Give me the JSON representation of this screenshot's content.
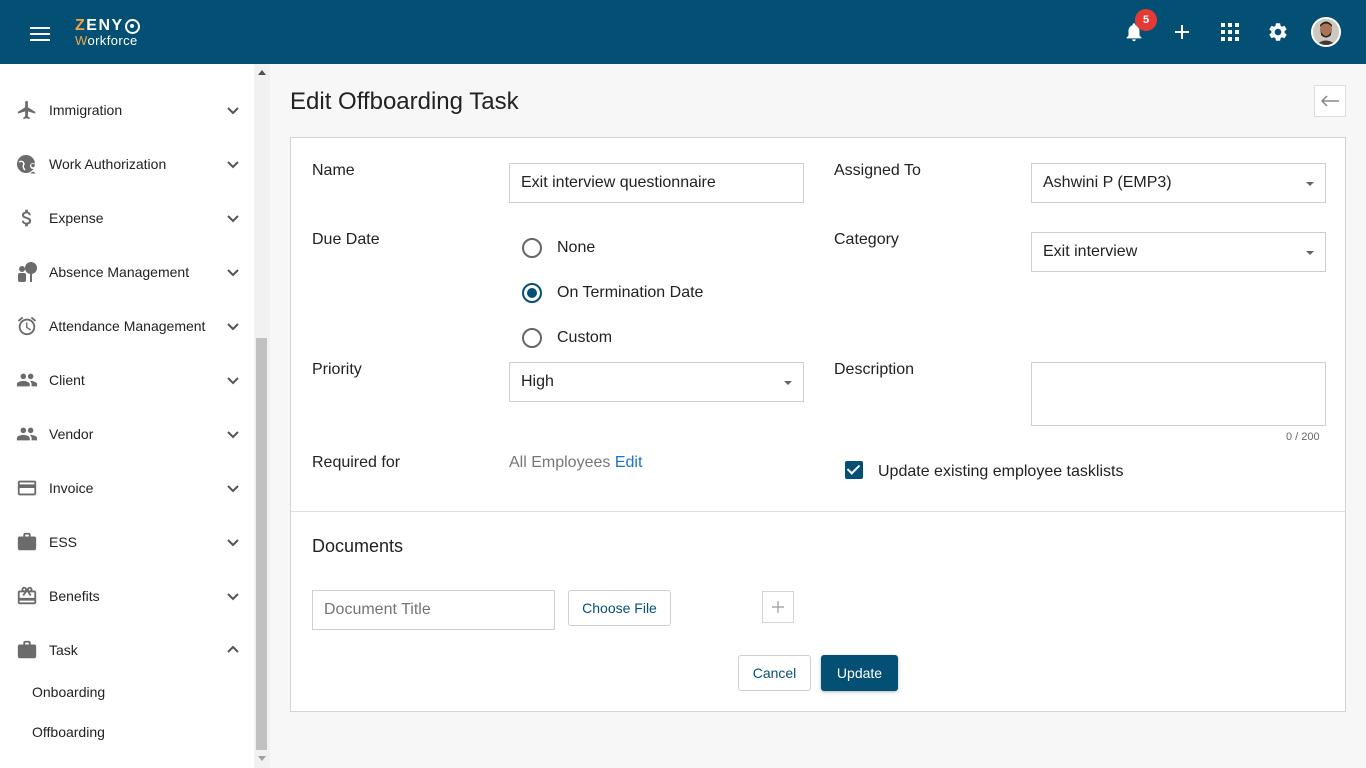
{
  "header": {
    "brand_top_z": "Z",
    "brand_top_rest": "ENY",
    "brand_bottom_w": "W",
    "brand_bottom_rest": "orkforce",
    "notification_count": "5",
    "icons": [
      "menu-icon",
      "bell-icon",
      "plus-icon",
      "apps-grid-icon",
      "gear-icon",
      "user-avatar"
    ]
  },
  "sidebar": {
    "items": [
      {
        "label": "Immigration",
        "icon": "airplane-icon"
      },
      {
        "label": "Work Authorization",
        "icon": "globe-person-icon"
      },
      {
        "label": "Expense",
        "icon": "dollar-icon"
      },
      {
        "label": "Absence Management",
        "icon": "absence-icon"
      },
      {
        "label": "Attendance Management",
        "icon": "alarm-clock-icon"
      },
      {
        "label": "Client",
        "icon": "people-icon"
      },
      {
        "label": "Vendor",
        "icon": "people-icon"
      },
      {
        "label": "Invoice",
        "icon": "credit-card-icon"
      },
      {
        "label": "ESS",
        "icon": "briefcase-icon"
      },
      {
        "label": "Benefits",
        "icon": "gift-card-icon"
      },
      {
        "label": "Task",
        "icon": "briefcase-icon"
      }
    ],
    "task_subitems": [
      "Onboarding",
      "Offboarding"
    ]
  },
  "page": {
    "title": "Edit Offboarding Task"
  },
  "form": {
    "name_label": "Name",
    "name_value": "Exit interview questionnaire",
    "assigned_label": "Assigned To",
    "assigned_value": "Ashwini P (EMP3)",
    "due_label": "Due Date",
    "due_options": [
      "None",
      "On Termination Date",
      "Custom"
    ],
    "due_selected": "On Termination Date",
    "category_label": "Category",
    "category_value": "Exit interview",
    "priority_label": "Priority",
    "priority_value": "High",
    "description_label": "Description",
    "description_value": "",
    "description_counter": "0 / 200",
    "required_label": "Required for",
    "required_value": "All Employees",
    "required_edit": "Edit",
    "update_checkbox_label": "Update existing employee tasklists",
    "update_checkbox_checked": true
  },
  "documents": {
    "heading": "Documents",
    "title_placeholder": "Document Title",
    "choose_file_label": "Choose File"
  },
  "actions": {
    "cancel_label": "Cancel",
    "update_label": "Update"
  },
  "colors": {
    "primary": "#045074",
    "accent": "#f0a14a",
    "badge": "#e53935",
    "link": "#1a73c9"
  }
}
